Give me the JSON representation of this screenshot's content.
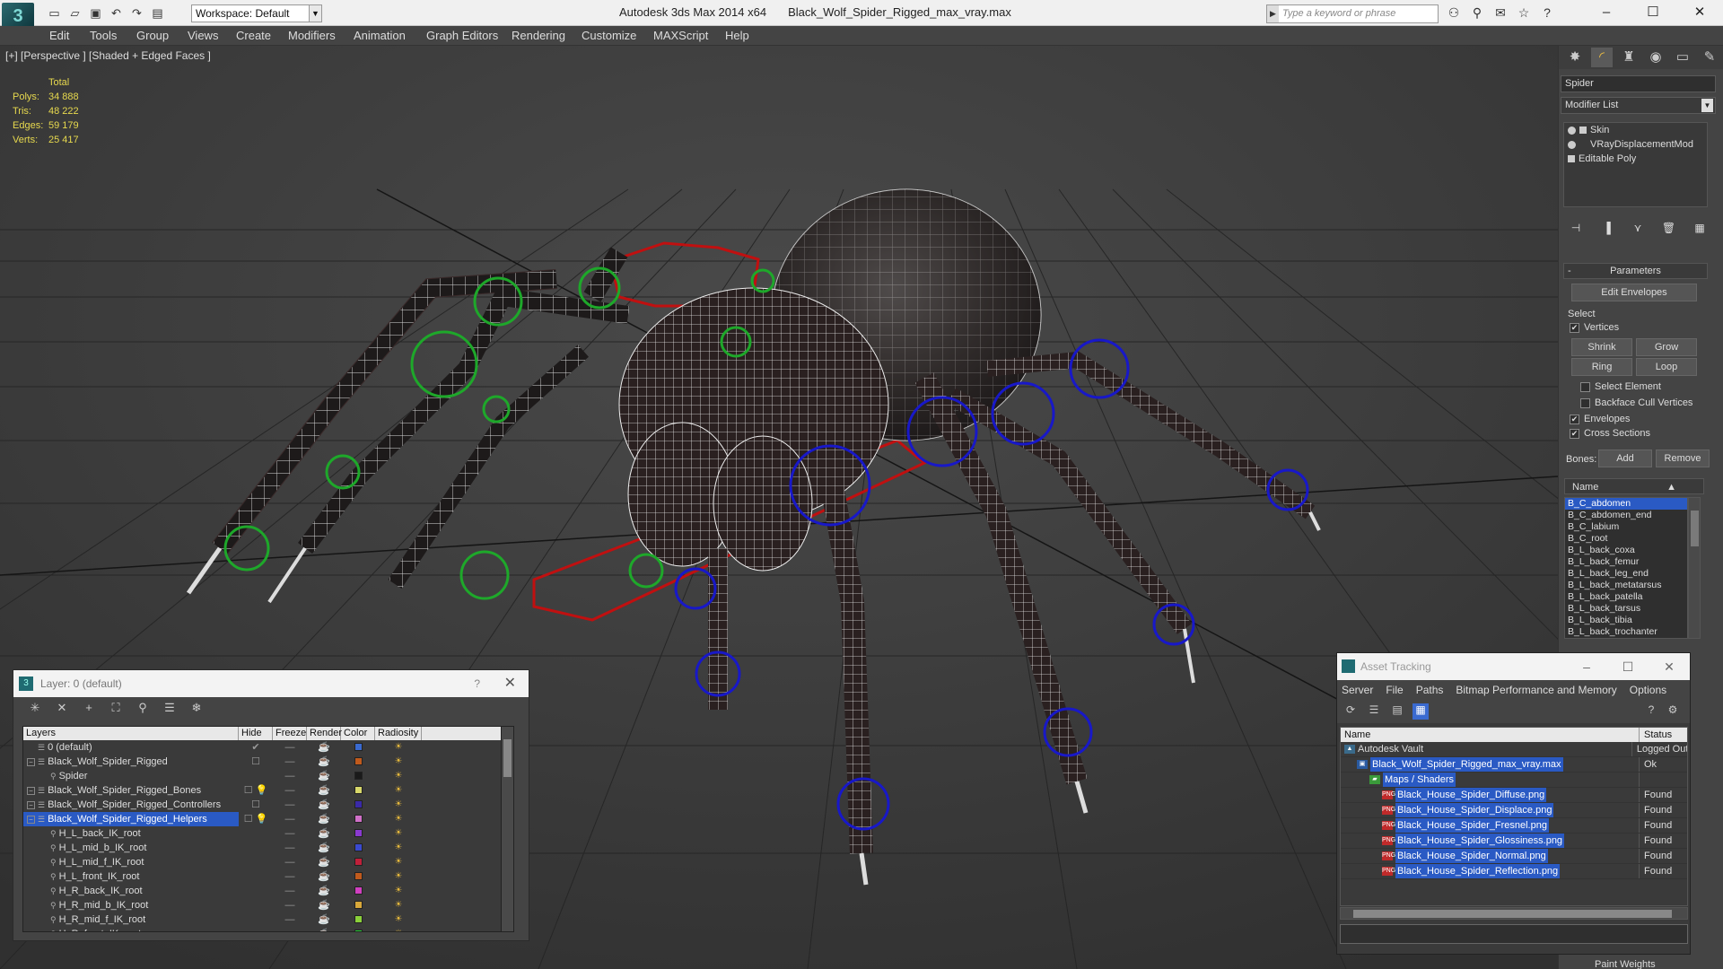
{
  "titlebar": {
    "workspace": "Workspace: Default",
    "app_name": "Autodesk 3ds Max  2014 x64",
    "file_name": "Black_Wolf_Spider_Rigged_max_vray.max",
    "search_placeholder": "Type a keyword or phrase"
  },
  "menu": [
    "Edit",
    "Tools",
    "Group",
    "Views",
    "Create",
    "Modifiers",
    "Animation",
    "Graph Editors",
    "Rendering",
    "Customize",
    "MAXScript",
    "Help"
  ],
  "viewport": {
    "label": "[+] [Perspective ] [Shaded + Edged Faces ]",
    "stats_header": "Total",
    "stats": [
      {
        "key": "Polys:",
        "value": "34 888"
      },
      {
        "key": "Tris:",
        "value": "48 222"
      },
      {
        "key": "Edges:",
        "value": "59 179"
      },
      {
        "key": "Verts:",
        "value": "25 417"
      }
    ]
  },
  "command_panel": {
    "object_name": "Spider",
    "modifier_list": "Modifier List",
    "stack": [
      "Skin",
      "VRayDisplacementMod",
      "Editable Poly"
    ],
    "rollout_title": "Parameters",
    "edit_envelopes": "Edit Envelopes",
    "select_label": "Select",
    "vertices_label": "Vertices",
    "shrink": "Shrink",
    "grow": "Grow",
    "ring": "Ring",
    "loop": "Loop",
    "select_element": "Select Element",
    "backface_cull": "Backface Cull Vertices",
    "envelopes": "Envelopes",
    "cross_sections": "Cross Sections",
    "bones_label": "Bones:",
    "add": "Add",
    "remove": "Remove",
    "name_header": "Name",
    "bones": [
      "B_C_abdomen",
      "B_C_abdomen_end",
      "B_C_labium",
      "B_C_root",
      "B_L_back_coxa",
      "B_L_back_femur",
      "B_L_back_leg_end",
      "B_L_back_metatarsus",
      "B_L_back_patella",
      "B_L_back_tarsus",
      "B_L_back_tibia",
      "B_L_back_trochanter"
    ],
    "bottom_label": "Paint Weights"
  },
  "layer_window": {
    "title": "Layer: 0 (default)",
    "help": "?",
    "columns": [
      "Layers",
      "Hide",
      "Freeze",
      "Render",
      "Color",
      "Radiosity"
    ],
    "rows": [
      {
        "name": "0 (default)",
        "color": "#3a6ad0",
        "hide": "✔"
      },
      {
        "name": "Black_Wolf_Spider_Rigged",
        "color": "#c05a1c",
        "hide": "☐"
      },
      {
        "name": "Spider",
        "color": "#1a1a1a",
        "hide": ""
      },
      {
        "name": "Black_Wolf_Spider_Rigged_Bones",
        "color": "#d8d86a",
        "hide": "☐ 💡"
      },
      {
        "name": "Black_Wolf_Spider_Rigged_Controllers",
        "color": "#3a2aa8",
        "hide": "☐"
      },
      {
        "name": "Black_Wolf_Spider_Rigged_Helpers",
        "color": "#d070c8",
        "hide": "☐ 💡"
      },
      {
        "name": "H_L_back_IK_root",
        "color": "#8a3ad0",
        "hide": ""
      },
      {
        "name": "H_L_mid_b_IK_root",
        "color": "#3a4ad0",
        "hide": ""
      },
      {
        "name": "H_L_mid_f_IK_root",
        "color": "#c0203a",
        "hide": ""
      },
      {
        "name": "H_L_front_IK_root",
        "color": "#c05a1c",
        "hide": ""
      },
      {
        "name": "H_R_back_IK_root",
        "color": "#d040c0",
        "hide": ""
      },
      {
        "name": "H_R_mid_b_IK_root",
        "color": "#d8a83a",
        "hide": ""
      },
      {
        "name": "H_R_mid_f_IK_root",
        "color": "#8ad03a",
        "hide": ""
      },
      {
        "name": "H_R_front_IK_root",
        "color": "#2ad03a",
        "hide": ""
      }
    ]
  },
  "asset_window": {
    "title": "Asset Tracking",
    "menu": [
      "Server",
      "File",
      "Paths",
      "Bitmap Performance and Memory",
      "Options"
    ],
    "columns": [
      "Name",
      "Status"
    ],
    "rows": [
      {
        "name": "Autodesk Vault",
        "status": "Logged Out",
        "indent": 0,
        "icon": "vault"
      },
      {
        "name": "Black_Wolf_Spider_Rigged_max_vray.max",
        "status": "Ok",
        "indent": 1,
        "icon": "max"
      },
      {
        "name": "Maps / Shaders",
        "status": "",
        "indent": 2,
        "icon": "folder"
      },
      {
        "name": "Black_House_Spider_Diffuse.png",
        "status": "Found",
        "indent": 3,
        "icon": "png"
      },
      {
        "name": "Black_House_Spider_Displace.png",
        "status": "Found",
        "indent": 3,
        "icon": "png"
      },
      {
        "name": "Black_House_Spider_Fresnel.png",
        "status": "Found",
        "indent": 3,
        "icon": "png"
      },
      {
        "name": "Black_House_Spider_Glossiness.png",
        "status": "Found",
        "indent": 3,
        "icon": "png"
      },
      {
        "name": "Black_House_Spider_Normal.png",
        "status": "Found",
        "indent": 3,
        "icon": "png"
      },
      {
        "name": "Black_House_Spider_Reflection.png",
        "status": "Found",
        "indent": 3,
        "icon": "png"
      }
    ]
  },
  "colors": {
    "ik_green": "#1ea82a",
    "ik_blue": "#1818c8",
    "selection_red": "#c01010",
    "accent_blue": "#2a5ac4"
  }
}
